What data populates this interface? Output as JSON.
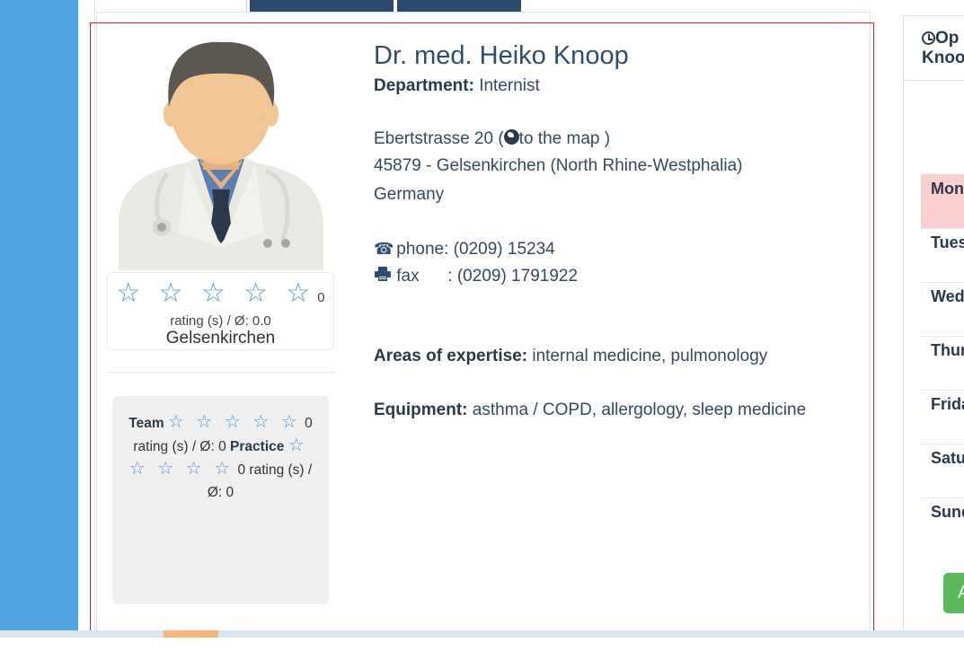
{
  "doctor": {
    "name": "Dr. med. Heiko Knoop",
    "department_label": "Department:",
    "department": "Internist",
    "address": {
      "street": "Ebertstrasse 20 (",
      "map_link": "to the map )",
      "city_line": "45879 - Gelsenkirchen (North Rhine-Westphalia)",
      "country": "Germany"
    },
    "phone": "phone: (0209) 15234",
    "fax": "fax      : (0209) 1791922",
    "expertise_label": "Areas of expertise:",
    "expertise": "internal medicine, pulmonology",
    "equipment_label": "Equipment:",
    "equipment": "asthma / COPD, allergology, sleep medicine"
  },
  "rating": {
    "stars": "☆ ☆ ☆ ☆ ☆",
    "count": "0",
    "summary": "rating (s) / Ø: 0.0",
    "city": "Gelsenkirchen"
  },
  "subratings": {
    "team_label": "Team",
    "team_stars": "☆ ☆ ☆ ☆ ☆",
    "team_text": "0 rating (s) / Ø: 0",
    "practice_label": "Practice",
    "practice_stars": "☆ ☆ ☆ ☆ ☆",
    "practice_text": "0 rating (s) / Ø: 0"
  },
  "opening_hours": {
    "title_line1": "Op",
    "title_line2": "Knoo",
    "days": [
      "Mon",
      "Tues",
      "Wed",
      "Thur",
      "Frida",
      "Satu",
      "Sund"
    ],
    "button_label": "A"
  },
  "icons": {
    "phone": "phone-icon",
    "fax": "printer-icon",
    "globe": "globe-icon",
    "clock": "clock-icon",
    "avatar": "doctor-avatar"
  },
  "colors": {
    "accent_blue": "#4fa3e0",
    "star_blue": "#4a9bdc",
    "heading": "#2d4e73",
    "highlight_red": "#d9201f",
    "active_day": "#fccfcf",
    "button_green": "#5cb85c"
  }
}
